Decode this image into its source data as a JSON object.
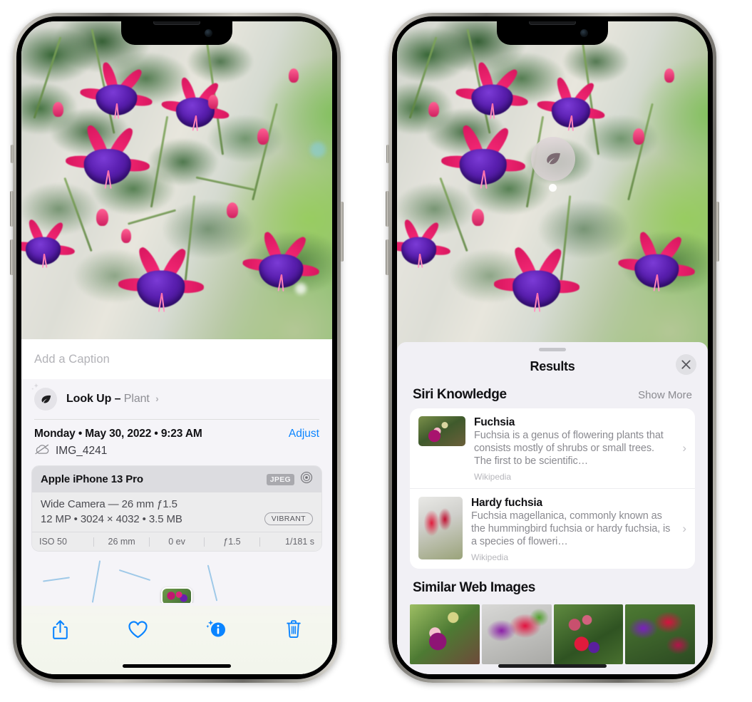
{
  "left_phone": {
    "photo": {
      "alt": "fuchsia-flowers-photo"
    },
    "caption": {
      "placeholder": "Add a Caption",
      "value": ""
    },
    "lookup": {
      "label": "Look Up –",
      "subject": "Plant",
      "chevron": "›",
      "icon": "leaf-icon",
      "sparkle_icon": "sparkles-icon"
    },
    "metadata": {
      "date": "Monday • May 30, 2022 • 9:23 AM",
      "adjust_label": "Adjust",
      "filename": "IMG_4241",
      "cloud_icon": "cloud-slash-icon"
    },
    "exif": {
      "model": "Apple iPhone 13 Pro",
      "format_tag": "JPEG",
      "aperture_icon": "aperture-icon",
      "lens_line": "Wide Camera — 26 mm ƒ1.5",
      "size_line": "12 MP • 3024 × 4032 • 3.5 MB",
      "style_tag": "VIBRANT",
      "settings": [
        "ISO 50",
        "26 mm",
        "0 ev",
        "ƒ1.5",
        "1/181 s"
      ]
    },
    "toolbar": {
      "share_label": "share-icon",
      "favorite_label": "heart-icon",
      "info_label": "info-sparkle-icon",
      "delete_label": "trash-icon"
    }
  },
  "right_phone": {
    "badge": {
      "icon": "leaf-icon"
    },
    "sheet": {
      "title": "Results",
      "close_label": "✕"
    },
    "siri_knowledge": {
      "title": "Siri Knowledge",
      "show_more": "Show More",
      "items": [
        {
          "title": "Fuchsia",
          "description": "Fuchsia is a genus of flowering plants that consists mostly of shrubs or small trees. The first to be scientific…",
          "source": "Wikipedia",
          "chevron": "›"
        },
        {
          "title": "Hardy fuchsia",
          "description": "Fuchsia magellanica, commonly known as the hummingbird fuchsia or hardy fuchsia, is a species of floweri…",
          "source": "Wikipedia",
          "chevron": "›"
        }
      ]
    },
    "similar_web_images": {
      "title": "Similar Web Images",
      "count": 4
    }
  },
  "colors": {
    "accent_blue": "#0a84ff",
    "sheet_bg": "#f1f0f5",
    "panel_bg": "#f5f4f8",
    "card_bg": "#ffffff",
    "muted_text": "#8a8a90"
  }
}
